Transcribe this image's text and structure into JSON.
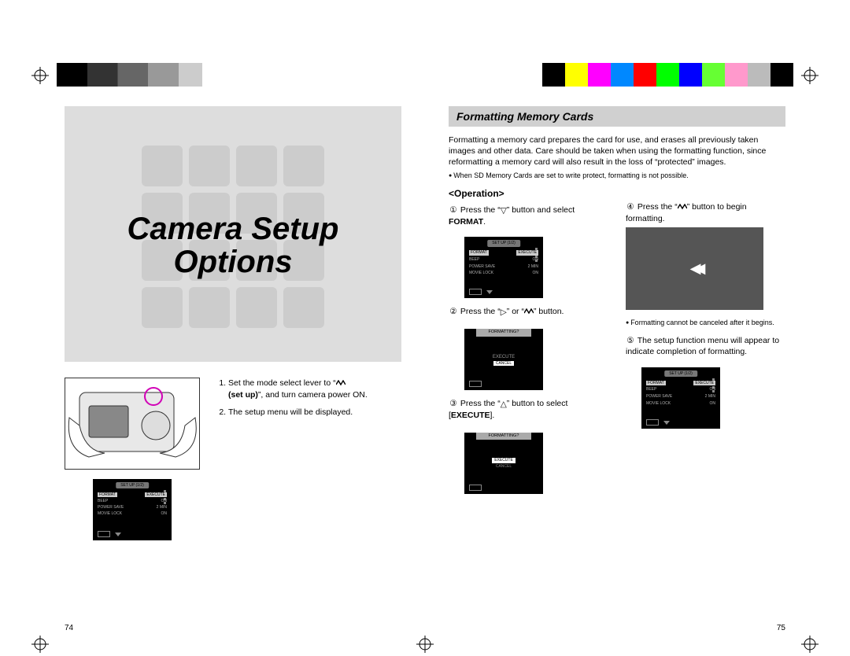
{
  "color_strip": [
    "#000000",
    "#333333",
    "#666666",
    "#999999",
    "#cccccc",
    "#ffffff",
    "#ffff00",
    "#ff00ff",
    "#00ffff",
    "#ff0000",
    "#00ff00",
    "#0000ff",
    "#66ff33",
    "#ff99cc",
    "#bbbbbb",
    "#000000"
  ],
  "left": {
    "hero_line1": "Camera Setup",
    "hero_line2": "Options",
    "step1_pre": "Set the mode select lever to “",
    "step1_bold": "(set up)",
    "step1_post": "”, and turn camera power ON.",
    "step2": "The setup menu will be displayed.",
    "page_num": "74",
    "lcd_setup": {
      "header": "SET UP (1/2)",
      "rows": [
        [
          "FORMAT",
          "EXECUTE"
        ],
        [
          "BEEP",
          "ON"
        ],
        [
          "POWER SAVE",
          "2 MIN"
        ],
        [
          "MOVIE LOCK",
          "ON"
        ]
      ]
    }
  },
  "right": {
    "section_title": "Formatting Memory Cards",
    "intro": "Formatting a memory card prepares the card for use, and erases all previously taken images and other data. Care should be taken when using the formatting function, since reformatting a memory card will also result in the loss of “protected” images.",
    "note_top": "When SD Memory Cards are set to write protect, formatting is not possible.",
    "operation_head": "<Operation>",
    "colA": {
      "s1a": "Press the “",
      "s1b": "” button and select ",
      "s1bold": "FORMAT",
      "s2a": "Press the “",
      "s2mid": "” or “",
      "s2b": "” button.",
      "s3a": "Press the “",
      "s3b": "” button to select [",
      "s3bold": "EXECUTE",
      "s3c": "].",
      "formatting_q": "FORMATTING?",
      "execute": "EXECUTE",
      "cancel": "CANCEL"
    },
    "colB": {
      "s4a": "Press the “",
      "s4b": "” button to begin formatting.",
      "note_mid": "Formatting cannot be canceled after it begins.",
      "s5": "The setup function menu will appear to indicate completion of formatting."
    },
    "page_num": "75"
  }
}
